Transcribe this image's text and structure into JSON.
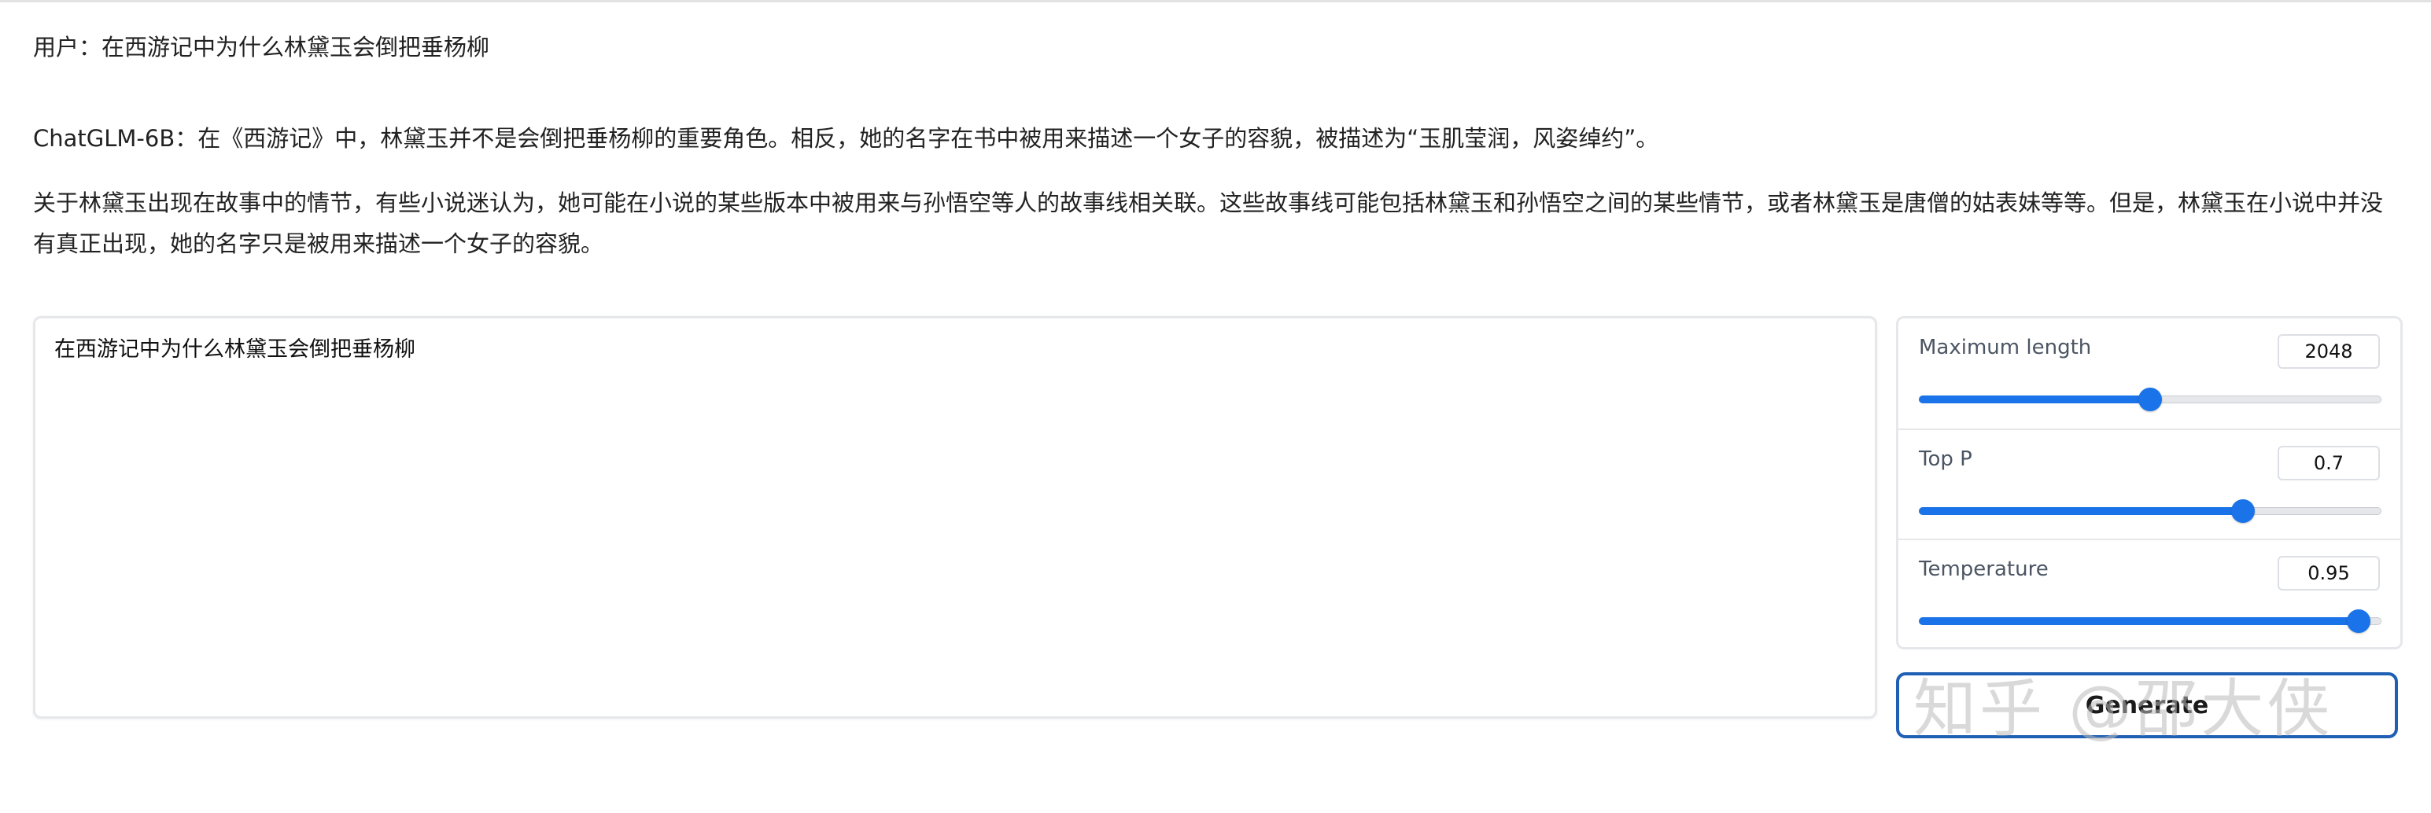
{
  "chat": {
    "user_line": "用户：在西游记中为什么林黛玉会倒把垂杨柳",
    "bot_para1": "ChatGLM-6B：在《西游记》中，林黛玉并不是会倒把垂杨柳的重要角色。相反，她的名字在书中被用来描述一个女子的容貌，被描述为“玉肌莹润，风姿绰约”。",
    "bot_para2": "关于林黛玉出现在故事中的情节，有些小说迷认为，她可能在小说的某些版本中被用来与孙悟空等人的故事线相关联。这些故事线可能包括林黛玉和孙悟空之间的某些情节，或者林黛玉是唐僧的姑表妹等等。但是，林黛玉在小说中并没有真正出现，她的名字只是被用来描述一个女子的容貌。"
  },
  "input": {
    "value": "在西游记中为什么林黛玉会倒把垂杨柳"
  },
  "settings": [
    {
      "label": "Maximum length",
      "value": "2048",
      "fraction": 0.5
    },
    {
      "label": "Top P",
      "value": "0.7",
      "fraction": 0.7
    },
    {
      "label": "Temperature",
      "value": "0.95",
      "fraction": 0.95
    }
  ],
  "generate": {
    "label": "Generate"
  },
  "watermark": {
    "text": "知乎 @邵大侠"
  },
  "colors": {
    "accent": "#1a73e8",
    "button_border": "#1f5fb4"
  }
}
